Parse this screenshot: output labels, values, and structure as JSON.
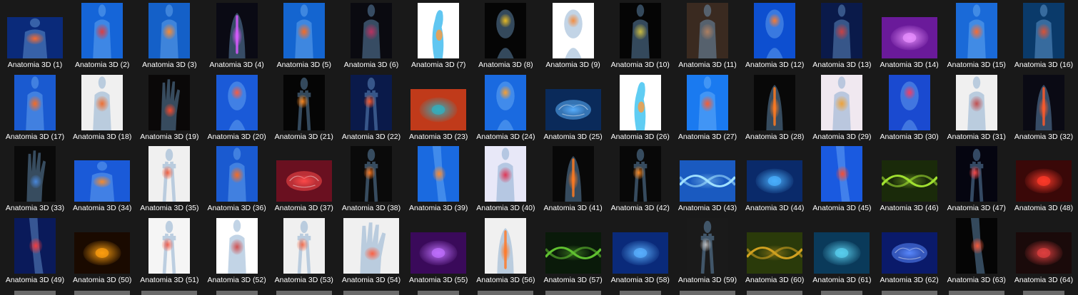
{
  "items": [
    {
      "label": "Anatomia 3D (1)",
      "bg": "#0a2a7a",
      "fg": "#ff6a2a",
      "shape": "body",
      "orient": "l"
    },
    {
      "label": "Anatomia 3D (2)",
      "bg": "#1565d8",
      "fg": "#e23a3a",
      "shape": "body",
      "orient": "p"
    },
    {
      "label": "Anatomia 3D (3)",
      "bg": "#1460c8",
      "fg": "#ff8a2a",
      "shape": "body",
      "orient": "p"
    },
    {
      "label": "Anatomia 3D (4)",
      "bg": "#0a0a14",
      "fg": "#d85aff",
      "shape": "spine",
      "orient": "p"
    },
    {
      "label": "Anatomia 3D (5)",
      "bg": "#1465d0",
      "fg": "#ff6a1a",
      "shape": "body",
      "orient": "p"
    },
    {
      "label": "Anatomia 3D (6)",
      "bg": "#0a0a10",
      "fg": "#c03060",
      "shape": "body",
      "orient": "p"
    },
    {
      "label": "Anatomia 3D (7)",
      "bg": "#ffffff",
      "fg": "#38b8ee",
      "shape": "side",
      "orient": "p"
    },
    {
      "label": "Anatomia 3D (8)",
      "bg": "#050505",
      "fg": "#f0c020",
      "shape": "head",
      "orient": "p"
    },
    {
      "label": "Anatomia 3D (9)",
      "bg": "#ffffff",
      "fg": "#f58a3a",
      "shape": "head",
      "orient": "p"
    },
    {
      "label": "Anatomia 3D (10)",
      "bg": "#050505",
      "fg": "#d0c040",
      "shape": "body",
      "orient": "p"
    },
    {
      "label": "Anatomia 3D (11)",
      "bg": "#3a2a20",
      "fg": "#b08060",
      "shape": "body",
      "orient": "p"
    },
    {
      "label": "Anatomia 3D (12)",
      "bg": "#0d4fd0",
      "fg": "#ff7a2a",
      "shape": "head",
      "orient": "p"
    },
    {
      "label": "Anatomia 3D (13)",
      "bg": "#0a1a4a",
      "fg": "#d04040",
      "shape": "body",
      "orient": "p"
    },
    {
      "label": "Anatomia 3D (14)",
      "bg": "#6a1a9a",
      "fg": "#e890ff",
      "shape": "glow",
      "orient": "l"
    },
    {
      "label": "Anatomia 3D (15)",
      "bg": "#1a6ad8",
      "fg": "#ff6a2a",
      "shape": "body",
      "orient": "p"
    },
    {
      "label": "Anatomia 3D (16)",
      "bg": "#0a3a6a",
      "fg": "#e05030",
      "shape": "body",
      "orient": "p"
    },
    {
      "label": "Anatomia 3D (17)",
      "bg": "#1a5ad0",
      "fg": "#ff6a1a",
      "shape": "body",
      "orient": "p"
    },
    {
      "label": "Anatomia 3D (18)",
      "bg": "#f0f0f0",
      "fg": "#f06a2a",
      "shape": "body",
      "orient": "p"
    },
    {
      "label": "Anatomia 3D (19)",
      "bg": "#0a0808",
      "fg": "#ff4a2a",
      "shape": "hand",
      "orient": "p"
    },
    {
      "label": "Anatomia 3D (20)",
      "bg": "#1a5ad8",
      "fg": "#ff5a3a",
      "shape": "head",
      "orient": "p"
    },
    {
      "label": "Anatomia 3D (21)",
      "bg": "#050505",
      "fg": "#ff8a20",
      "shape": "skel",
      "orient": "p"
    },
    {
      "label": "Anatomia 3D (22)",
      "bg": "#0a1a4a",
      "fg": "#ff5a2a",
      "shape": "skel",
      "orient": "p"
    },
    {
      "label": "Anatomia 3D (23)",
      "bg": "#c03a1a",
      "fg": "#30b0c0",
      "shape": "glow",
      "orient": "l"
    },
    {
      "label": "Anatomia 3D (24)",
      "bg": "#1a6ae0",
      "fg": "#ffa02a",
      "shape": "head",
      "orient": "p"
    },
    {
      "label": "Anatomia 3D (25)",
      "bg": "#0a2a5a",
      "fg": "#5ab0ff",
      "shape": "brain",
      "orient": "l"
    },
    {
      "label": "Anatomia 3D (26)",
      "bg": "#ffffff",
      "fg": "#38c0f0",
      "shape": "side",
      "orient": "p"
    },
    {
      "label": "Anatomia 3D (27)",
      "bg": "#1a7af0",
      "fg": "#ff5a2a",
      "shape": "body",
      "orient": "p"
    },
    {
      "label": "Anatomia 3D (28)",
      "bg": "#080808",
      "fg": "#ff7a20",
      "shape": "spine",
      "orient": "p"
    },
    {
      "label": "Anatomia 3D (29)",
      "bg": "#f0e8f0",
      "fg": "#f0a030",
      "shape": "body",
      "orient": "p"
    },
    {
      "label": "Anatomia 3D (30)",
      "bg": "#1a4ad0",
      "fg": "#ff3a5a",
      "shape": "head",
      "orient": "p"
    },
    {
      "label": "Anatomia 3D (31)",
      "bg": "#f0f0f0",
      "fg": "#c04a4a",
      "shape": "body",
      "orient": "p"
    },
    {
      "label": "Anatomia 3D (32)",
      "bg": "#0a0a14",
      "fg": "#ff5a2a",
      "shape": "spine",
      "orient": "p"
    },
    {
      "label": "Anatomia 3D (33)",
      "bg": "#0a0a0a",
      "fg": "#4a8ae0",
      "shape": "hand",
      "orient": "p"
    },
    {
      "label": "Anatomia 3D (34)",
      "bg": "#1a5ad8",
      "fg": "#ff8a20",
      "shape": "body",
      "orient": "l"
    },
    {
      "label": "Anatomia 3D (35)",
      "bg": "#f0f0f0",
      "fg": "#f05a3a",
      "shape": "skel",
      "orient": "p"
    },
    {
      "label": "Anatomia 3D (36)",
      "bg": "#1a5ad0",
      "fg": "#ff6a1a",
      "shape": "body",
      "orient": "p"
    },
    {
      "label": "Anatomia 3D (37)",
      "bg": "#6a1020",
      "fg": "#ff4a4a",
      "shape": "brain",
      "orient": "l"
    },
    {
      "label": "Anatomia 3D (38)",
      "bg": "#0a0a0a",
      "fg": "#ff7a20",
      "shape": "skel",
      "orient": "p"
    },
    {
      "label": "Anatomia 3D (39)",
      "bg": "#1a6ae0",
      "fg": "#ff8a2a",
      "shape": "knee",
      "orient": "p"
    },
    {
      "label": "Anatomia 3D (40)",
      "bg": "#e8e8f8",
      "fg": "#e03050",
      "shape": "body",
      "orient": "p"
    },
    {
      "label": "Anatomia 3D (41)",
      "bg": "#080808",
      "fg": "#ff7a20",
      "shape": "spine",
      "orient": "p"
    },
    {
      "label": "Anatomia 3D (42)",
      "bg": "#080808",
      "fg": "#ff8a20",
      "shape": "skel",
      "orient": "p"
    },
    {
      "label": "Anatomia 3D (43)",
      "bg": "#1a5ac0",
      "fg": "#a0e0ff",
      "shape": "dna",
      "orient": "l"
    },
    {
      "label": "Anatomia 3D (44)",
      "bg": "#0a2a6a",
      "fg": "#4ab0ff",
      "shape": "glow",
      "orient": "l"
    },
    {
      "label": "Anatomia 3D (45)",
      "bg": "#1a5ae0",
      "fg": "#ff4a2a",
      "shape": "knee",
      "orient": "p"
    },
    {
      "label": "Anatomia 3D (46)",
      "bg": "#1a2a0a",
      "fg": "#a0e030",
      "shape": "dna",
      "orient": "l"
    },
    {
      "label": "Anatomia 3D (47)",
      "bg": "#050510",
      "fg": "#ff4a4a",
      "shape": "skel",
      "orient": "p"
    },
    {
      "label": "Anatomia 3D (48)",
      "bg": "#3a0808",
      "fg": "#ff3a2a",
      "shape": "glow",
      "orient": "l"
    },
    {
      "label": "Anatomia 3D (49)",
      "bg": "#0a1a5a",
      "fg": "#ff3a3a",
      "shape": "knee",
      "orient": "p"
    },
    {
      "label": "Anatomia 3D (50)",
      "bg": "#1a0a00",
      "fg": "#ffa010",
      "shape": "glow",
      "orient": "l"
    },
    {
      "label": "Anatomia 3D (51)",
      "bg": "#f5f5f5",
      "fg": "#f05a4a",
      "shape": "skel",
      "orient": "p"
    },
    {
      "label": "Anatomia 3D (52)",
      "bg": "#ffffff",
      "fg": "#d04a4a",
      "shape": "body",
      "orient": "p"
    },
    {
      "label": "Anatomia 3D (53)",
      "bg": "#f0f0f0",
      "fg": "#f06a4a",
      "shape": "skel",
      "orient": "p"
    },
    {
      "label": "Anatomia 3D (54)",
      "bg": "#f0f0f0",
      "fg": "#ff5a3a",
      "shape": "hand",
      "orient": "sq"
    },
    {
      "label": "Anatomia 3D (55)",
      "bg": "#3a0a5a",
      "fg": "#c070ff",
      "shape": "glow",
      "orient": "l"
    },
    {
      "label": "Anatomia 3D (56)",
      "bg": "#f0f0f0",
      "fg": "#ff7a2a",
      "shape": "spine",
      "orient": "p"
    },
    {
      "label": "Anatomia 3D (57)",
      "bg": "#0a1a0a",
      "fg": "#60c030",
      "shape": "dna",
      "orient": "l"
    },
    {
      "label": "Anatomia 3D (58)",
      "bg": "#0a2a7a",
      "fg": "#5ab0ff",
      "shape": "glow",
      "orient": "l"
    },
    {
      "label": "Anatomia 3D (59)",
      "bg": "#1a1a1a",
      "fg": "#c0c0c0",
      "shape": "skel",
      "orient": "p"
    },
    {
      "label": "Anatomia 3D (60)",
      "bg": "#2a3a0a",
      "fg": "#d0a020",
      "shape": "dna",
      "orient": "l"
    },
    {
      "label": "Anatomia 3D (61)",
      "bg": "#0a3a5a",
      "fg": "#5ad0f0",
      "shape": "glow",
      "orient": "l"
    },
    {
      "label": "Anatomia 3D (62)",
      "bg": "#0a1a6a",
      "fg": "#5a8aff",
      "shape": "brain",
      "orient": "l"
    },
    {
      "label": "Anatomia 3D (63)",
      "bg": "#050505",
      "fg": "#ff5a3a",
      "shape": "knee",
      "orient": "p"
    },
    {
      "label": "Anatomia 3D (64)",
      "bg": "#1a0a0a",
      "fg": "#e04040",
      "shape": "glow",
      "orient": "l"
    }
  ]
}
